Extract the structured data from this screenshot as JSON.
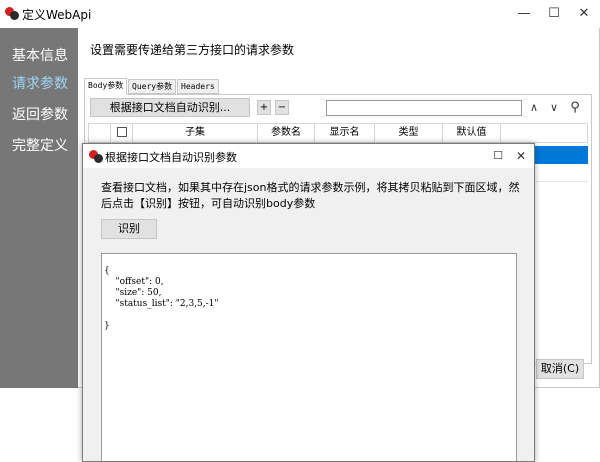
{
  "main_window": {
    "title": "定义WebApi",
    "caption_buttons": {
      "minimize": "—",
      "maximize": "☐",
      "close": "✕"
    }
  },
  "sidebar": {
    "items": [
      {
        "label": "基本信息",
        "active": false
      },
      {
        "label": "请求参数",
        "active": true
      },
      {
        "label": "返回参数",
        "active": false
      },
      {
        "label": "完整定义",
        "active": false
      }
    ]
  },
  "content": {
    "heading": "设置需要传递给第三方接口的请求参数",
    "tabs": [
      {
        "label": "Body参数",
        "active": true
      },
      {
        "label": "Query参数",
        "active": false
      },
      {
        "label": "Headers",
        "active": false
      }
    ],
    "toolbar": {
      "auto_detect_label": "根据接口文档自动识别...",
      "add_label": "+",
      "remove_label": "−",
      "search_placeholder": "",
      "up_icon": "∧",
      "down_icon": "∨",
      "search_icon": "⚲"
    },
    "grid": {
      "columns": [
        "",
        "",
        "子集",
        "参数名",
        "显示名",
        "类型",
        "默认值"
      ]
    },
    "cancel_label": "取消(C)"
  },
  "dialog": {
    "title": "根据接口文档自动识别参数",
    "maximize_icon": "☐",
    "close_icon": "✕",
    "description": "查看接口文档，如果其中存在json格式的请求参数示例，将其拷贝粘贴到下面区域，然后点击【识别】按钮，可自动识别body参数",
    "detect_button_label": "识别",
    "json_text": "{\n    \"offset\": 0,\n    \"size\": 50,\n    \"status_list\": \"2,3,5,-1\"\n\n}"
  },
  "colors": {
    "sidebar_bg": "#777777",
    "sidebar_active_text": "#9fd6f5",
    "selection_blue": "#0078d7",
    "icon_red": "#d21f1f"
  }
}
